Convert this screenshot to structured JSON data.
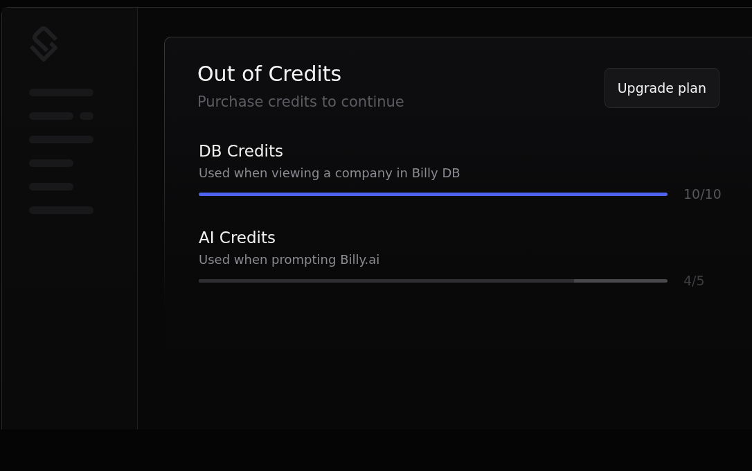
{
  "card": {
    "title": "Out of Credits",
    "subtitle": "Purchase credits to continue",
    "button": "Upgrade plan"
  },
  "credits": [
    {
      "name": "DB Credits",
      "description": "Used when viewing a company in Billy DB",
      "level": 1,
      "reading": "10/10",
      "exhausted": true
    },
    {
      "name": "AI Credits",
      "description": "Used when prompting Billy.ai",
      "level": 0.8,
      "reading": "4/5",
      "exhausted": false
    }
  ]
}
